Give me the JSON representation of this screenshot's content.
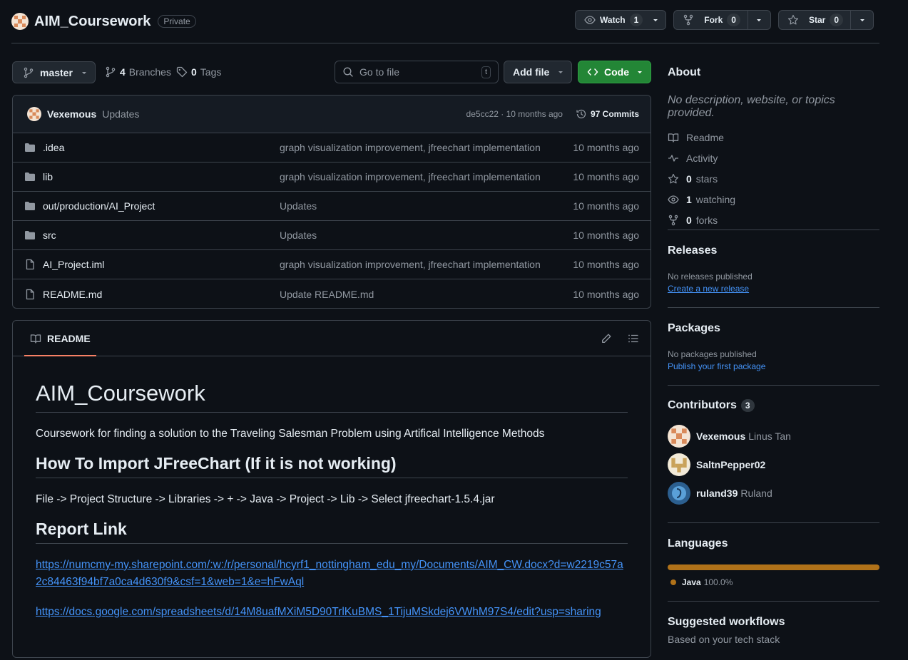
{
  "repo": {
    "name": "AIM_Coursework",
    "visibility": "Private"
  },
  "actions": {
    "watch_label": "Watch",
    "watch_count": "1",
    "fork_label": "Fork",
    "fork_count": "0",
    "star_label": "Star",
    "star_count": "0"
  },
  "branch_bar": {
    "branch": "master",
    "branches_count": "4",
    "branches_label": "Branches",
    "tags_count": "0",
    "tags_label": "Tags",
    "search_placeholder": "Go to file",
    "search_shortcut": "t",
    "add_file_label": "Add file",
    "code_label": "Code"
  },
  "latest_commit": {
    "author": "Vexemous",
    "message": "Updates",
    "sha_time": "de5cc22 · 10 months ago",
    "commits_count": "97 Commits"
  },
  "files": [
    {
      "type": "folder",
      "name": ".idea",
      "message": "graph visualization improvement, jfreechart implementation",
      "time": "10 months ago"
    },
    {
      "type": "folder",
      "name": "lib",
      "message": "graph visualization improvement, jfreechart implementation",
      "time": "10 months ago"
    },
    {
      "type": "folder",
      "name": "out/production/AI_Project",
      "message": "Updates",
      "time": "10 months ago"
    },
    {
      "type": "folder",
      "name": "src",
      "message": "Updates",
      "time": "10 months ago"
    },
    {
      "type": "file",
      "name": "AI_Project.iml",
      "message": "graph visualization improvement, jfreechart implementation",
      "time": "10 months ago"
    },
    {
      "type": "file",
      "name": "README.md",
      "message": "Update README.md",
      "time": "10 months ago"
    }
  ],
  "readme": {
    "tab_label": "README",
    "title": "AIM_Coursework",
    "description": "Coursework for finding a solution to the Traveling Salesman Problem using Artifical Intelligence Methods",
    "h2_import": "How To Import JFreeChart (If it is not working)",
    "import_steps": "File -> Project Structure -> Libraries -> + -> Java -> Project -> Lib -> Select jfreechart-1.5.4.jar",
    "h2_report": "Report Link",
    "link1": "https://numcmy-my.sharepoint.com/:w:/r/personal/hcyrf1_nottingham_edu_my/Documents/AIM_CW.docx?d=w2219c57a2c84463f94bf7a0ca4d630f9&csf=1&web=1&e=hFwAql",
    "link2": "https://docs.google.com/spreadsheets/d/14M8uafMXiM5D90TrlKuBMS_1TijuMSkdej6VWhM97S4/edit?usp=sharing"
  },
  "sidebar": {
    "about_title": "About",
    "about_desc": "No description, website, or topics provided.",
    "readme_label": "Readme",
    "activity_label": "Activity",
    "stars_count": "0",
    "stars_label": "stars",
    "watching_count": "1",
    "watching_label": "watching",
    "forks_count": "0",
    "forks_label": "forks",
    "releases_title": "Releases",
    "releases_text": "No releases published",
    "releases_link": "Create a new release",
    "packages_title": "Packages",
    "packages_text": "No packages published",
    "packages_link": "Publish your first package",
    "contributors_title": "Contributors",
    "contributors_count": "3",
    "contributors": [
      {
        "login": "Vexemous",
        "name": "Linus Tan"
      },
      {
        "login": "SaltnPepper02",
        "name": ""
      },
      {
        "login": "ruland39",
        "name": "Ruland"
      }
    ],
    "languages_title": "Languages",
    "language_name": "Java",
    "language_percent": "100.0%",
    "language_color": "#b07219",
    "workflows_title": "Suggested workflows",
    "workflows_sub": "Based on your tech stack"
  }
}
